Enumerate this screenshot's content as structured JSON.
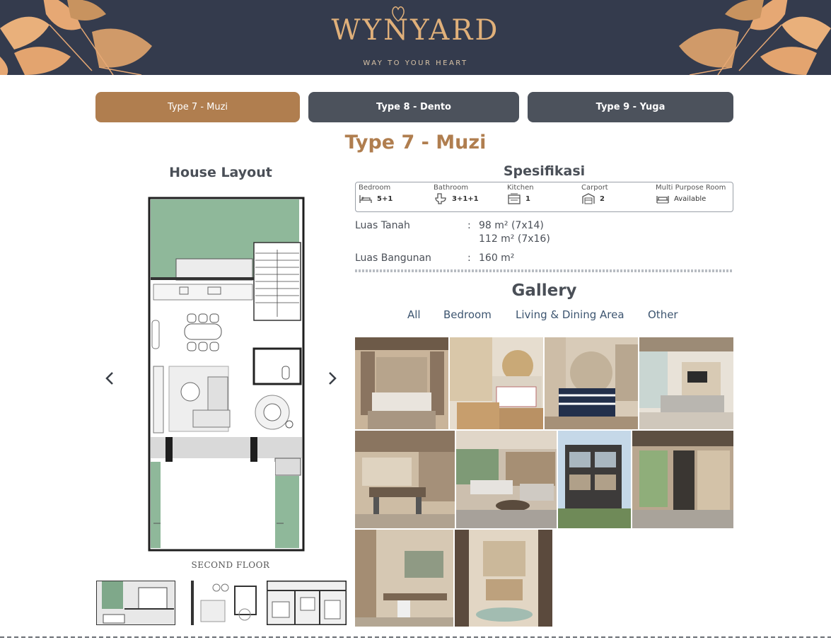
{
  "header": {
    "brand": "WYNYARD",
    "tagline": "WAY TO YOUR HEART"
  },
  "tabs": [
    {
      "label": "Type 7 - Muzi",
      "active": true
    },
    {
      "label": "Type 8 - Dento",
      "active": false
    },
    {
      "label": "Type 9 - Yuga",
      "active": false
    }
  ],
  "type_title": "Type 7 - Muzi",
  "layout": {
    "heading": "House Layout",
    "floor_label": "SECOND FLOOR",
    "prev_icon": "chevron-left-icon",
    "next_icon": "chevron-right-icon"
  },
  "specs": {
    "heading": "Spesifikasi",
    "items": [
      {
        "label": "Bedroom",
        "value": "5+1",
        "icon": "bed-icon"
      },
      {
        "label": "Bathroom",
        "value": "3+1+1",
        "icon": "toilet-icon"
      },
      {
        "label": "Kitchen",
        "value": "1",
        "icon": "stove-icon"
      },
      {
        "label": "Carport",
        "value": "2",
        "icon": "garage-icon"
      },
      {
        "label": "Multi Purpose Room",
        "value": "Available",
        "icon": "furniture-icon"
      }
    ],
    "land_label": "Luas Tanah",
    "land_value_1": "98 m² (7x14)",
    "land_value_2": "112 m² (7x16)",
    "building_label": "Luas Bangunan",
    "building_value": "160 m²",
    "separator": ":"
  },
  "gallery": {
    "heading": "Gallery",
    "filters": [
      "All",
      "Bedroom",
      "Living & Dining Area",
      "Other"
    ]
  },
  "colors": {
    "accent": "#b07e4f",
    "banner": "#343b4d",
    "tab_inactive": "#4c525c",
    "plan_green": "#8fb89a"
  }
}
